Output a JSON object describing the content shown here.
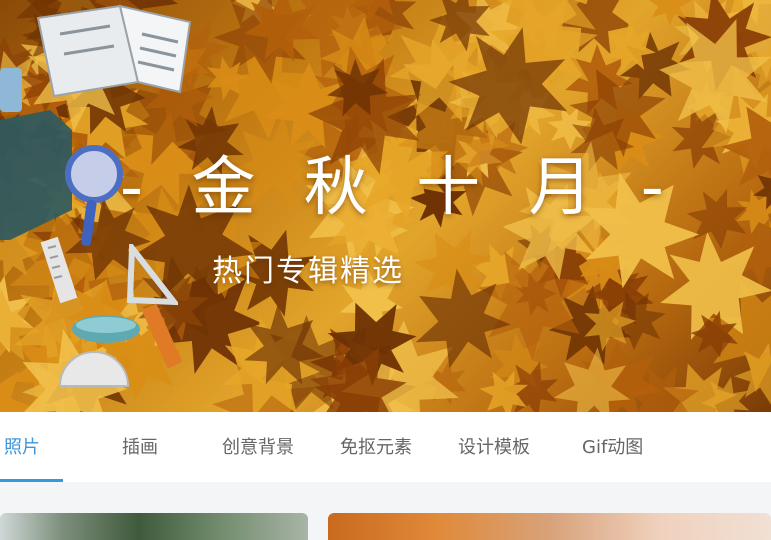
{
  "banner": {
    "title": "- 金 秋 十 月 -",
    "subtitle": "热门专辑精选",
    "colors": {
      "leaf_dark": "#8a3f05",
      "leaf_mid": "#d98d16",
      "leaf_light": "#f1c04a"
    }
  },
  "tabs": [
    {
      "label": "照片",
      "active": true
    },
    {
      "label": "插画",
      "active": false
    },
    {
      "label": "创意背景",
      "active": false
    },
    {
      "label": "免抠元素",
      "active": false
    },
    {
      "label": "设计模板",
      "active": false
    },
    {
      "label": "Gif动图",
      "active": false
    }
  ],
  "accent_color": "#3a96dd"
}
